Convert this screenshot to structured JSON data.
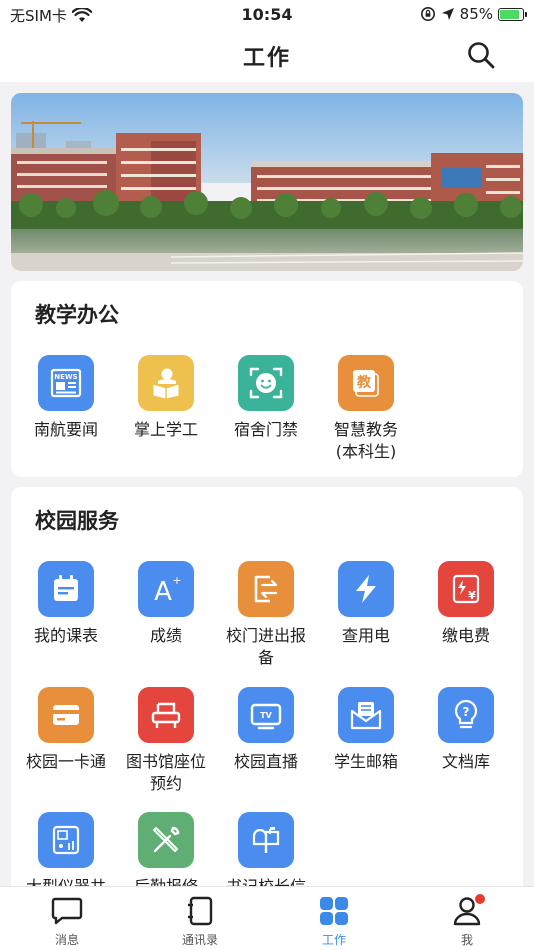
{
  "status_bar": {
    "carrier": "无SIM卡",
    "time": "10:54",
    "battery_text": "85%",
    "battery_level": 0.85
  },
  "header": {
    "title": "工作"
  },
  "sections": {
    "teaching": {
      "title": "教学办公",
      "items": [
        {
          "label": "南航要闻",
          "icon": "news-icon",
          "color": "#4a8def"
        },
        {
          "label": "掌上学工",
          "icon": "student-reading-icon",
          "color": "#eec04d"
        },
        {
          "label": "宿舍门禁",
          "icon": "face-scan-icon",
          "color": "#3bb39a"
        },
        {
          "label": "智慧教务\n(本科生)",
          "icon": "teaching-affairs-icon",
          "color": "#e88f3c"
        }
      ]
    },
    "campus": {
      "title": "校园服务",
      "items": [
        {
          "label": "我的课表",
          "icon": "calendar-icon",
          "color": "#4a8def"
        },
        {
          "label": "成绩",
          "icon": "grade-a-plus-icon",
          "color": "#4a8def"
        },
        {
          "label": "校门进出报备",
          "icon": "gate-exit-icon",
          "color": "#e88f3c"
        },
        {
          "label": "查用电",
          "icon": "lightning-icon",
          "color": "#4a8def"
        },
        {
          "label": "缴电费",
          "icon": "electric-bill-icon",
          "color": "#e4463e"
        },
        {
          "label": "校园一卡通",
          "icon": "card-icon",
          "color": "#e88f3c"
        },
        {
          "label": "图书馆座位预约",
          "icon": "seat-icon",
          "color": "#e4463e"
        },
        {
          "label": "校园直播",
          "icon": "tv-icon",
          "color": "#4a8def"
        },
        {
          "label": "学生邮箱",
          "icon": "mail-icon",
          "color": "#4a8def"
        },
        {
          "label": "文档库",
          "icon": "lightbulb-icon",
          "color": "#4a8def"
        },
        {
          "label": "大型仪器共",
          "icon": "instrument-icon",
          "color": "#4a8def"
        },
        {
          "label": "后勤报修",
          "icon": "repair-tools-icon",
          "color": "#5fae73"
        },
        {
          "label": "书记校长信",
          "icon": "mailbox-icon",
          "color": "#4a8def"
        }
      ]
    }
  },
  "tab_bar": {
    "items": [
      {
        "label": "消息",
        "icon": "chat-bubble-icon"
      },
      {
        "label": "通讯录",
        "icon": "contacts-book-icon"
      },
      {
        "label": "工作",
        "icon": "grid-apps-icon",
        "active": true
      },
      {
        "label": "我",
        "icon": "person-icon"
      }
    ]
  }
}
